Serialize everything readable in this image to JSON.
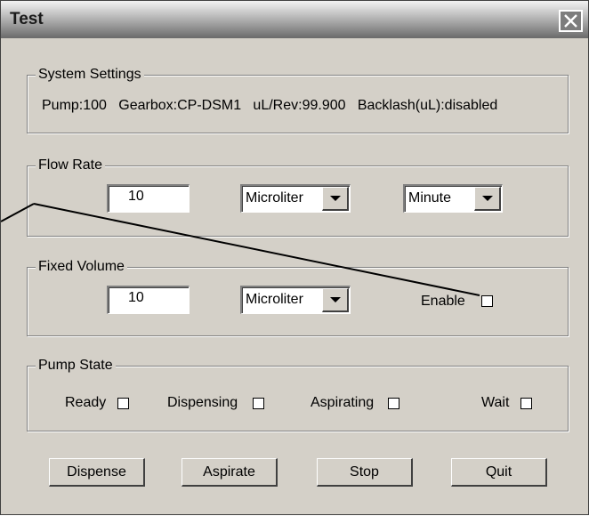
{
  "window": {
    "title": "Test",
    "close_icon": "close-icon"
  },
  "system_settings": {
    "legend": "System Settings",
    "info": "Pump:100   Gearbox:CP-DSM1   uL/Rev:99.900   Backlash(uL):disabled"
  },
  "flow_rate": {
    "legend": "Flow Rate",
    "value": "10",
    "unit_selected": "Microliter",
    "time_selected": "Minute"
  },
  "fixed_volume": {
    "legend": "Fixed Volume",
    "value": "10",
    "unit_selected": "Microliter",
    "enable_label": "Enable",
    "enable_checked": false
  },
  "pump_state": {
    "legend": "Pump State",
    "states": [
      {
        "label": "Ready",
        "checked": false
      },
      {
        "label": "Dispensing",
        "checked": false
      },
      {
        "label": "Aspirating",
        "checked": false
      },
      {
        "label": "Wait",
        "checked": false
      }
    ]
  },
  "buttons": {
    "dispense": "Dispense",
    "aspirate": "Aspirate",
    "stop": "Stop",
    "quit": "Quit"
  }
}
